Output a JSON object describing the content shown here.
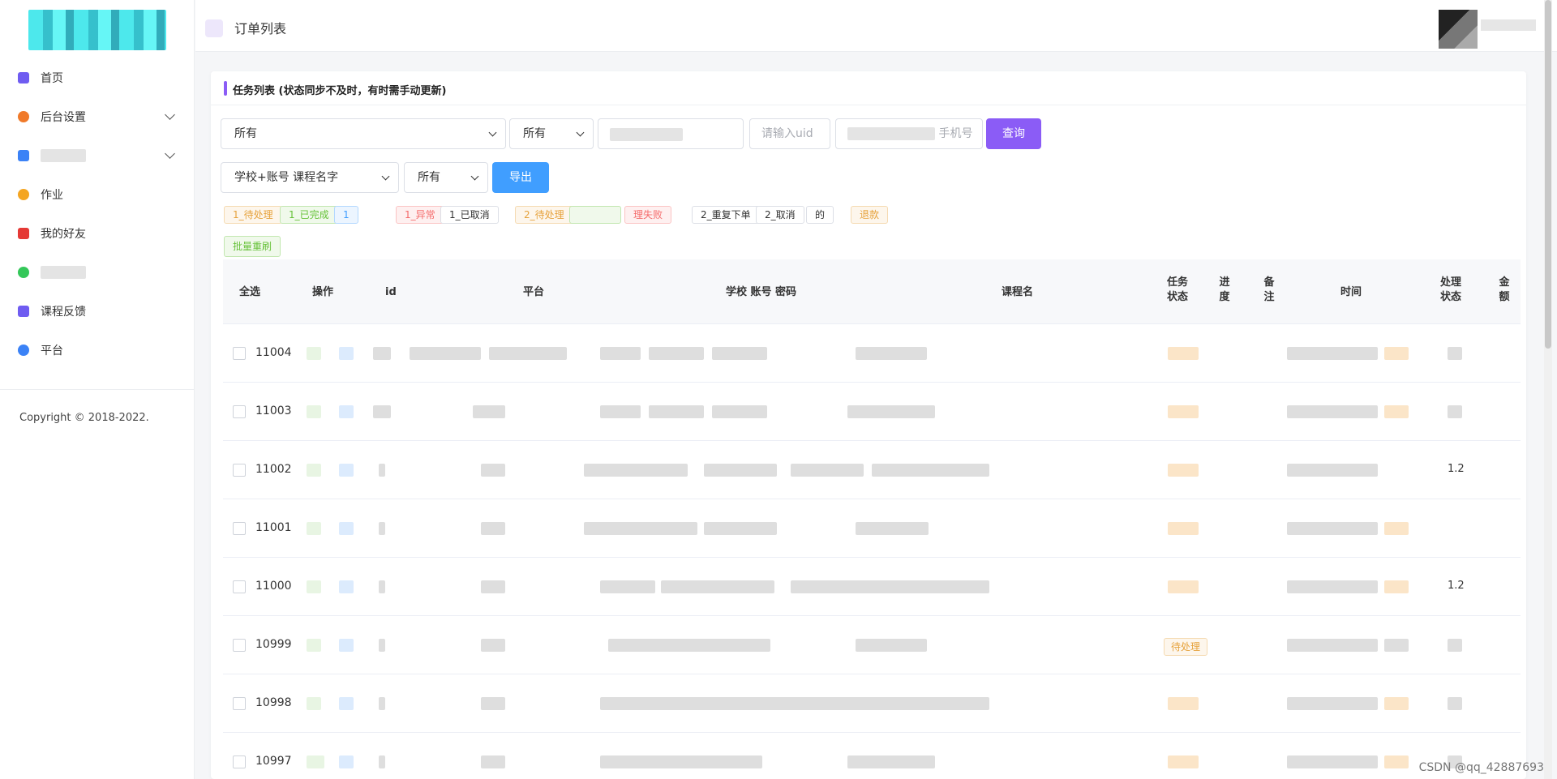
{
  "sidebar": {
    "items": [
      {
        "label": "首页",
        "icon": "home-icon",
        "color": "#6f5cf1",
        "expand": false
      },
      {
        "label": "后台设置",
        "icon": "gear-icon",
        "color": "#f07a2a",
        "expand": true
      },
      {
        "label": "",
        "icon": "send-icon",
        "color": "#3b82f6",
        "expand": true
      },
      {
        "label": "作业",
        "icon": "apps-icon",
        "color": "#f4a521",
        "expand": false
      },
      {
        "label": "我的好友",
        "icon": "user-icon",
        "color": "#e53935",
        "expand": false
      },
      {
        "label": "",
        "icon": "doc-icon",
        "color": "#34c759",
        "expand": false
      },
      {
        "label": "课程反馈",
        "icon": "feedback-icon",
        "color": "#6f5cf1",
        "expand": false
      },
      {
        "label": "平台",
        "icon": "platform-icon",
        "color": "#3b82f6",
        "expand": false
      }
    ],
    "copyright": "Copyright © 2018-2022."
  },
  "header": {
    "title": "订单列表"
  },
  "card": {
    "title": "任务列表 (状态同步不及时，有时需手动更新)"
  },
  "filters": {
    "select1": "所有",
    "select2": "所有",
    "uid_placeholder": "请输入uid",
    "phone_placeholder": "手机号",
    "query_label": "查询",
    "select3": "学校+账号 课程名字",
    "select4": "所有",
    "export_label": "导出"
  },
  "status_tags": [
    {
      "label": "1_待处理",
      "style": "orange"
    },
    {
      "label": "1_已完成",
      "style": "green"
    },
    {
      "label": "1",
      "style": "blue"
    },
    {
      "label": "1_异常",
      "style": "red"
    },
    {
      "label": "1_已取消",
      "style": "gray"
    },
    {
      "label": "2_待处理",
      "style": "orange"
    },
    {
      "label": "",
      "style": "green"
    },
    {
      "label": "理失败",
      "style": "red"
    },
    {
      "label": "2_重复下单",
      "style": "gray"
    },
    {
      "label": "2_取消",
      "style": "gray"
    },
    {
      "label": "的",
      "style": "gray"
    },
    {
      "label": "退款",
      "style": "orange"
    }
  ],
  "batch_refresh_label": "批量重刷",
  "table": {
    "headers": [
      "全选",
      "操作",
      "id",
      "平台",
      "学校 账号 密码",
      "课程名",
      "任务状态",
      "进度",
      "备注",
      "时间",
      "处理状态",
      "金额"
    ],
    "rows": [
      {
        "id": "11004",
        "status": "",
        "amount": ""
      },
      {
        "id": "11003",
        "status": "",
        "amount": ""
      },
      {
        "id": "11002",
        "status": "",
        "amount": "1.2"
      },
      {
        "id": "11001",
        "status": "",
        "amount": ""
      },
      {
        "id": "11000",
        "status": "",
        "amount": "1.2"
      },
      {
        "id": "10999",
        "status": "待处理",
        "amount": ""
      },
      {
        "id": "10998",
        "status": "",
        "amount": ""
      },
      {
        "id": "10997",
        "status": "",
        "amount": ""
      }
    ]
  },
  "watermark": "CSDN @qq_42887693"
}
